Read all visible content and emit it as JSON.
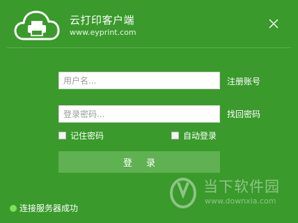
{
  "app": {
    "title": "云打印客户端",
    "url": "www.eyprint.com"
  },
  "form": {
    "username_placeholder": "用户名...",
    "password_placeholder": "登录密码...",
    "register_label": "注册账号",
    "forgot_label": "找回密码",
    "remember_label": "记住密码",
    "auto_login_label": "自动登录",
    "login_label": "登 录"
  },
  "status": {
    "text": "连接服务器成功",
    "indicator_color": "#7fe05a"
  },
  "watermark": {
    "title": "当下软件园",
    "url": "www.downxia.com"
  },
  "colors": {
    "background": "#3a9a2c",
    "button": "#5fb152"
  },
  "icons": {
    "logo": "cloud-printer-icon",
    "close": "close-icon"
  }
}
